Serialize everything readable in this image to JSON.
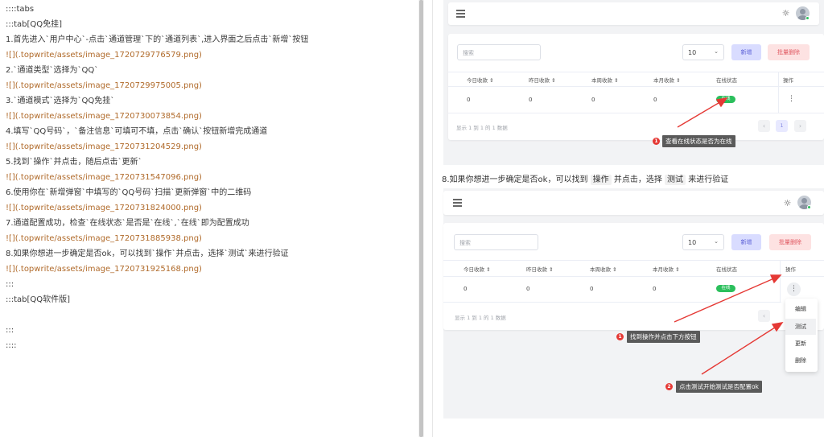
{
  "editor": {
    "lines": [
      {
        "text": "::::tabs",
        "kind": "text"
      },
      {
        "text": ":::tab[QQ免挂]",
        "kind": "text"
      },
      {
        "text": "1.首先进入`用户中心`-点击`通道管理`下的`通道列表`,进入界面之后点击`新增`按钮",
        "kind": "text"
      },
      {
        "text": "![](.topwrite/assets/image_1720729776579.png)",
        "kind": "img"
      },
      {
        "text": "2.`通道类型`选择为`QQ`",
        "kind": "text"
      },
      {
        "text": "![](.topwrite/assets/image_1720729975005.png)",
        "kind": "img"
      },
      {
        "text": "3.`通道模式`选择为`QQ免挂`",
        "kind": "text"
      },
      {
        "text": "![](.topwrite/assets/image_1720730073854.png)",
        "kind": "img"
      },
      {
        "text": "4.填写`QQ号码`，`备注信息`可填可不填，点击`确认`按钮新增完成通道",
        "kind": "text"
      },
      {
        "text": "![](.topwrite/assets/image_1720731204529.png)",
        "kind": "img"
      },
      {
        "text": "5.找到`操作`并点击，随后点击`更新`",
        "kind": "text"
      },
      {
        "text": "![](.topwrite/assets/image_1720731547096.png)",
        "kind": "img"
      },
      {
        "text": "6.使用你在`新增弹窗`中填写的`QQ号码`扫描`更新弹窗`中的二维码",
        "kind": "text"
      },
      {
        "text": "![](.topwrite/assets/image_1720731824000.png)",
        "kind": "img"
      },
      {
        "text": "7.通道配置成功，检查`在线状态`是否是`在线`,`在线`即为配置成功",
        "kind": "text"
      },
      {
        "text": "![](.topwrite/assets/image_1720731885938.png)",
        "kind": "img"
      },
      {
        "text": "8.如果你想进一步确定是否ok，可以找到`操作`并点击，选择`测试`来进行验证",
        "kind": "text"
      },
      {
        "text": "![](.topwrite/assets/image_1720731925168.png)",
        "kind": "img"
      },
      {
        "text": ":::",
        "kind": "text"
      },
      {
        "text": ":::tab[QQ软件版]",
        "kind": "text"
      },
      {
        "text": "",
        "kind": "text"
      },
      {
        "text": ":::",
        "kind": "text"
      },
      {
        "text": "::::",
        "kind": "text"
      }
    ]
  },
  "preview": {
    "caption_prefix": "8.如果你想进一步确定是否ok，可以找到",
    "caption_op": "操作",
    "caption_mid": "并点击，选择",
    "caption_test": "测试",
    "caption_suffix": "来进行验证",
    "shot1": {
      "search_placeholder": "搜索",
      "page_size": "10",
      "new_label": "新增",
      "bulk_delete_label": "批量删除",
      "headers": [
        "今日收款 ⇕",
        "昨日收款 ⇕",
        "本周收款 ⇕",
        "本月收款 ⇕",
        "在线状态",
        "操作"
      ],
      "row": [
        "0",
        "0",
        "0",
        "0"
      ],
      "status": "在线",
      "kebab": "⋮",
      "footer": "显示 1 到 1 的 1 数据",
      "page_prev": "‹",
      "page_current": "1",
      "page_next": "›",
      "tip_num": "1",
      "tip_text": "查看在线状态是否为在线"
    },
    "shot2": {
      "search_placeholder": "搜索",
      "page_size": "10",
      "new_label": "新增",
      "bulk_delete_label": "批量删除",
      "headers": [
        "今日收款 ⇕",
        "昨日收款 ⇕",
        "本周收款 ⇕",
        "本月收款 ⇕",
        "在线状态",
        "操作"
      ],
      "row": [
        "0",
        "0",
        "0",
        "0"
      ],
      "status": "在线",
      "kebab": "⋮",
      "footer": "显示 1 到 1 的 1 数据",
      "page_prev": "‹",
      "menu": [
        "编辑",
        "测试",
        "更新",
        "删除"
      ],
      "tip1_num": "1",
      "tip1_text": "找到操作并点击下方按钮",
      "tip2_num": "2",
      "tip2_text": "点击测试开始测试是否配置ok"
    },
    "colors": {
      "accent": "#5a5fd6",
      "danger": "#e15b64",
      "online": "#2bbf5c",
      "arrow": "#e53935"
    }
  }
}
